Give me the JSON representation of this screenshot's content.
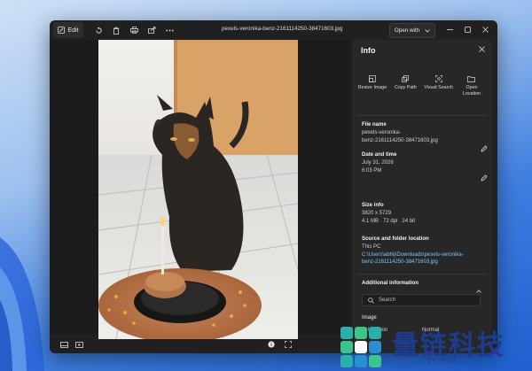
{
  "toolbar": {
    "edit_label": "Edit",
    "file_title": "pexels-veronika-benz-2161114250-38471603.jpg",
    "open_with_label": "Open with"
  },
  "info": {
    "title": "Info",
    "actions": [
      {
        "label": "Resize Image",
        "icon": "resize-icon"
      },
      {
        "label": "Copy Path",
        "icon": "copy-path-icon"
      },
      {
        "label": "Visual Search",
        "icon": "visual-search-icon"
      },
      {
        "label": "Open Location",
        "icon": "open-location-icon"
      }
    ],
    "file_name_label": "File name",
    "file_name_line1": "pexels-veronika-",
    "file_name_line2": "benz-2161114250-38471603.jpg",
    "date_label": "Date and time",
    "date_value": "July 31, 2026",
    "time_value": "6:03 PM",
    "size_label": "Size info",
    "dimensions": "3820 x 5729",
    "size_line": "4.1 MB   72 dpi   24 bit",
    "source_label": "Source and folder location",
    "source_device": "This PC",
    "path_line1": "C:\\Users\\abhij\\Downloads\\pexels-veronika-",
    "path_line2": "benz-2161114250-38471603.jpg",
    "additional_label": "Additional information",
    "search_placeholder": "Search",
    "image_label": "Image",
    "orientation_label": "Orientation",
    "orientation_value": "Normal"
  },
  "watermark": {
    "text": "量链科技",
    "sub": "QFSP.NET"
  }
}
